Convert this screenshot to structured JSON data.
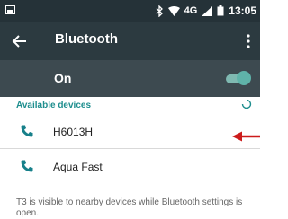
{
  "status_bar": {
    "network": "4G",
    "time": "13:05"
  },
  "toolbar": {
    "title": "Bluetooth"
  },
  "bluetooth_switch": {
    "label": "On",
    "state": "on"
  },
  "available_devices": {
    "header": "Available devices",
    "devices": [
      {
        "name": "H6013H",
        "icon": "phone-icon"
      },
      {
        "name": "Aqua Fast",
        "icon": "phone-icon"
      }
    ]
  },
  "footer_text": "T3 is visible to nearby devices while Bluetooth settings is open.",
  "colors": {
    "status_bar": "#253238",
    "toolbar": "#2c3a40",
    "switch_bar": "#3d4a50",
    "accent": "#1e8e8e",
    "toggle": "#5fb3a9",
    "annotation_arrow": "#cc1b1b"
  }
}
